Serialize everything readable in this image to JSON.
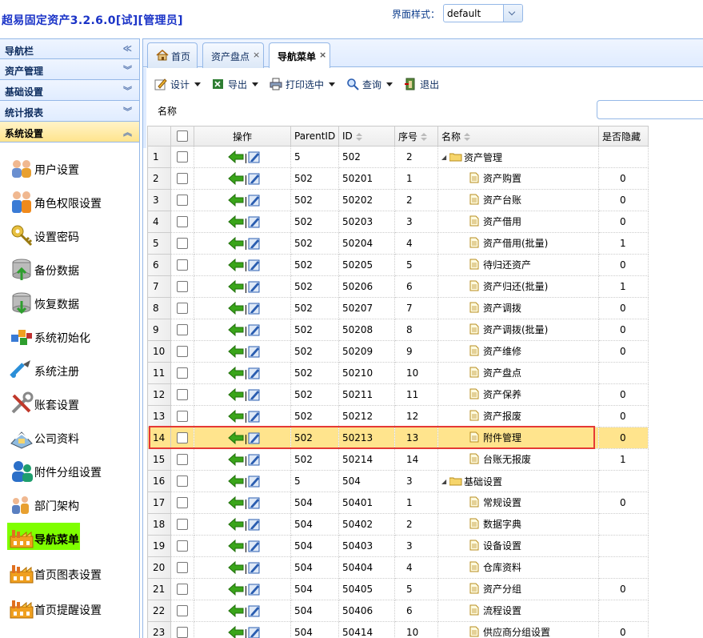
{
  "header": {
    "app_title": "超易固定资产3.2.6.0[试][管理员]",
    "theme_label": "界面样式：",
    "theme_value": "default"
  },
  "sidebar": {
    "nav_title": "导航栏",
    "sections": [
      "资产管理",
      "基础设置",
      "统计报表",
      "系统设置"
    ],
    "items": [
      {
        "label": "用户设置",
        "icon": "users-icon"
      },
      {
        "label": "角色权限设置",
        "icon": "role-icon"
      },
      {
        "label": "设置密码",
        "icon": "key-icon"
      },
      {
        "label": "备份数据",
        "icon": "backup-icon"
      },
      {
        "label": "恢复数据",
        "icon": "restore-icon"
      },
      {
        "label": "系统初始化",
        "icon": "init-icon"
      },
      {
        "label": "系统注册",
        "icon": "register-icon"
      },
      {
        "label": "账套设置",
        "icon": "tools-icon"
      },
      {
        "label": "公司资料",
        "icon": "company-icon"
      },
      {
        "label": "附件分组设置",
        "icon": "group-icon"
      },
      {
        "label": "部门架构",
        "icon": "org-icon"
      },
      {
        "label": "导航菜单",
        "icon": "factory-icon"
      },
      {
        "label": "首页图表设置",
        "icon": "factory-icon"
      },
      {
        "label": "首页提醒设置",
        "icon": "factory-icon"
      }
    ]
  },
  "tabs": [
    {
      "label": "首页",
      "icon": "home-icon",
      "closable": false
    },
    {
      "label": "资产盘点",
      "closable": true
    },
    {
      "label": "导航菜单",
      "closable": true
    }
  ],
  "toolbar": {
    "design": "设计",
    "export": "导出",
    "print": "打印选中",
    "query": "查询",
    "exit": "退出",
    "name_label": "名称"
  },
  "grid": {
    "columns": [
      "操作",
      "ParentID",
      "ID",
      "序号",
      "名称",
      "是否隐藏"
    ],
    "rows": [
      {
        "n": "1",
        "pid": "5",
        "id": "502",
        "seq": "2",
        "name": "资产管理",
        "folder": true,
        "hidden": ""
      },
      {
        "n": "2",
        "pid": "502",
        "id": "50201",
        "seq": "1",
        "name": "资产购置",
        "folder": false,
        "hidden": "0"
      },
      {
        "n": "3",
        "pid": "502",
        "id": "50202",
        "seq": "2",
        "name": "资产台账",
        "folder": false,
        "hidden": "0"
      },
      {
        "n": "4",
        "pid": "502",
        "id": "50203",
        "seq": "3",
        "name": "资产借用",
        "folder": false,
        "hidden": "0"
      },
      {
        "n": "5",
        "pid": "502",
        "id": "50204",
        "seq": "4",
        "name": "资产借用(批量)",
        "folder": false,
        "hidden": "1"
      },
      {
        "n": "6",
        "pid": "502",
        "id": "50205",
        "seq": "5",
        "name": "待归还资产",
        "folder": false,
        "hidden": "0"
      },
      {
        "n": "7",
        "pid": "502",
        "id": "50206",
        "seq": "6",
        "name": "资产归还(批量)",
        "folder": false,
        "hidden": "1"
      },
      {
        "n": "8",
        "pid": "502",
        "id": "50207",
        "seq": "7",
        "name": "资产调拨",
        "folder": false,
        "hidden": "0"
      },
      {
        "n": "9",
        "pid": "502",
        "id": "50208",
        "seq": "8",
        "name": "资产调拨(批量)",
        "folder": false,
        "hidden": "0"
      },
      {
        "n": "10",
        "pid": "502",
        "id": "50209",
        "seq": "9",
        "name": "资产维修",
        "folder": false,
        "hidden": "0"
      },
      {
        "n": "11",
        "pid": "502",
        "id": "50210",
        "seq": "10",
        "name": "资产盘点",
        "folder": false,
        "hidden": ""
      },
      {
        "n": "12",
        "pid": "502",
        "id": "50211",
        "seq": "11",
        "name": "资产保养",
        "folder": false,
        "hidden": "0"
      },
      {
        "n": "13",
        "pid": "502",
        "id": "50212",
        "seq": "12",
        "name": "资产报废",
        "folder": false,
        "hidden": "0"
      },
      {
        "n": "14",
        "pid": "502",
        "id": "50213",
        "seq": "13",
        "name": "附件管理",
        "folder": false,
        "hidden": "0",
        "selected": true
      },
      {
        "n": "15",
        "pid": "502",
        "id": "50214",
        "seq": "14",
        "name": "台账无报废",
        "folder": false,
        "hidden": "1"
      },
      {
        "n": "16",
        "pid": "5",
        "id": "504",
        "seq": "3",
        "name": "基础设置",
        "folder": true,
        "hidden": ""
      },
      {
        "n": "17",
        "pid": "504",
        "id": "50401",
        "seq": "1",
        "name": "常规设置",
        "folder": false,
        "hidden": "0"
      },
      {
        "n": "18",
        "pid": "504",
        "id": "50402",
        "seq": "2",
        "name": "数据字典",
        "folder": false,
        "hidden": ""
      },
      {
        "n": "19",
        "pid": "504",
        "id": "50403",
        "seq": "3",
        "name": "设备设置",
        "folder": false,
        "hidden": ""
      },
      {
        "n": "20",
        "pid": "504",
        "id": "50404",
        "seq": "4",
        "name": "仓库资料",
        "folder": false,
        "hidden": ""
      },
      {
        "n": "21",
        "pid": "504",
        "id": "50405",
        "seq": "5",
        "name": "资产分组",
        "folder": false,
        "hidden": "0"
      },
      {
        "n": "22",
        "pid": "504",
        "id": "50406",
        "seq": "6",
        "name": "流程设置",
        "folder": false,
        "hidden": ""
      },
      {
        "n": "23",
        "pid": "504",
        "id": "50414",
        "seq": "10",
        "name": "供应商分组设置",
        "folder": false,
        "hidden": "0"
      }
    ]
  }
}
